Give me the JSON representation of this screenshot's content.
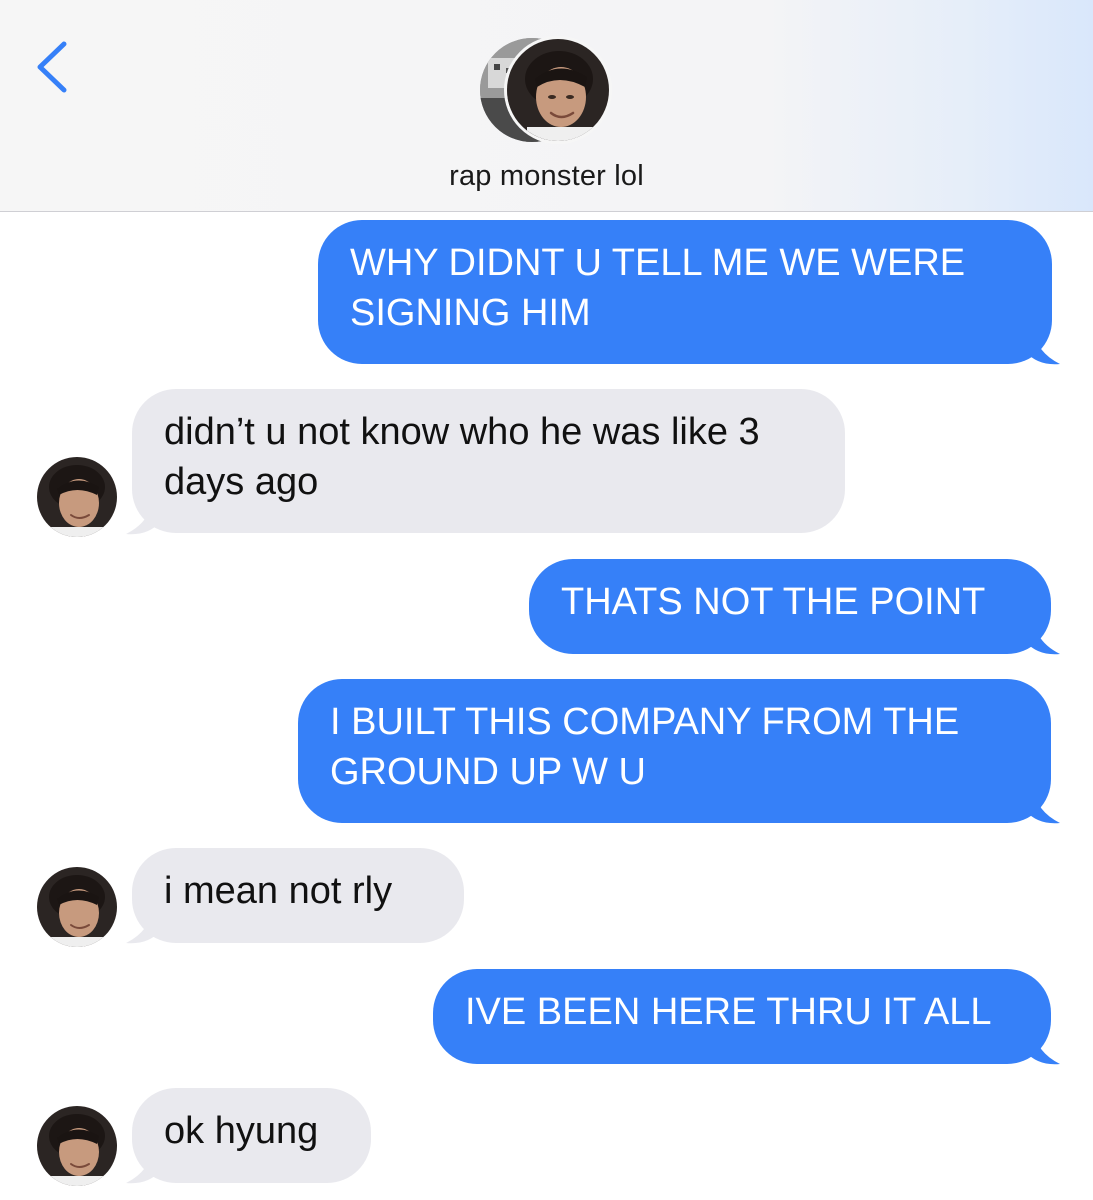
{
  "header": {
    "contact_name": "rap monster lol",
    "back_icon": "chevron-left-icon",
    "accent_color": "#3680f8"
  },
  "messages": [
    {
      "direction": "outgoing",
      "text": "WHY DIDNT U TELL ME WE WERE SIGNING HIM"
    },
    {
      "direction": "incoming",
      "text": "didn’t u not know who he was like 3 days ago"
    },
    {
      "direction": "outgoing",
      "text": "THATS NOT THE POINT"
    },
    {
      "direction": "outgoing",
      "text": "I BUILT THIS COMPANY FROM THE GROUND UP W U"
    },
    {
      "direction": "incoming",
      "text": "i mean not rly"
    },
    {
      "direction": "outgoing",
      "text": "IVE BEEN HERE THRU IT ALL"
    },
    {
      "direction": "incoming",
      "text": "ok hyung"
    }
  ],
  "colors": {
    "outgoing_bubble": "#3680f8",
    "incoming_bubble": "#e9e9ee",
    "header_bg": "#f6f6f6"
  }
}
